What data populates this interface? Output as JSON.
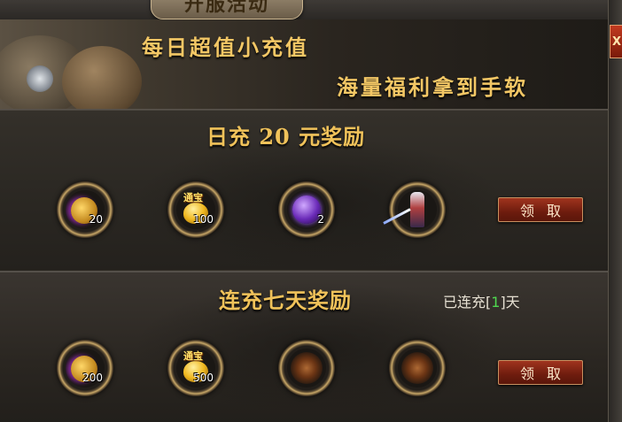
{
  "window": {
    "title": "开服活动",
    "close_label": "X"
  },
  "banner": {
    "line1": "每日超值小充值",
    "line2": "海量福利拿到手软"
  },
  "sections": [
    {
      "title": "日充 20 元奖励",
      "claim_label": "领取",
      "rewards": [
        {
          "icon": "purple-gold-coin-icon",
          "quantity": "20",
          "tag": ""
        },
        {
          "icon": "gold-ingot-icon",
          "quantity": "100",
          "tag": "通宝"
        },
        {
          "icon": "purple-orb-icon",
          "quantity": "2",
          "tag": ""
        },
        {
          "icon": "armored-warrior-icon",
          "quantity": "",
          "tag": ""
        }
      ]
    },
    {
      "title": "连充七天奖励",
      "progress": {
        "prefix": "已连充[",
        "days": "1",
        "suffix": "]天"
      },
      "claim_label": "领取",
      "rewards": [
        {
          "icon": "purple-gold-coin-icon",
          "quantity": "200",
          "tag": ""
        },
        {
          "icon": "gold-ingot-icon",
          "quantity": "500",
          "tag": "通宝"
        },
        {
          "icon": "fire-burst-icon",
          "quantity": "",
          "tag": ""
        },
        {
          "icon": "fire-burst-icon",
          "quantity": "",
          "tag": ""
        }
      ]
    }
  ]
}
